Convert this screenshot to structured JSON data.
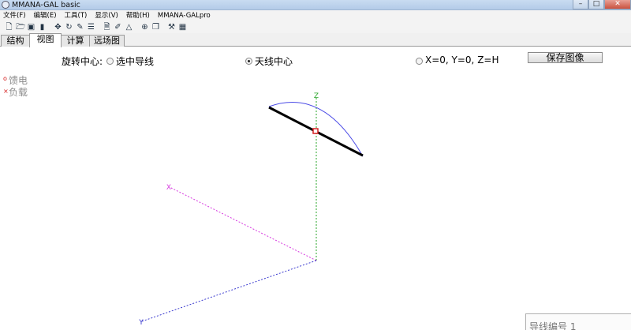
{
  "window": {
    "title": "MMANA-GAL basic",
    "minimize_glyph": "–",
    "maximize_glyph": "□",
    "close_glyph": "✕"
  },
  "menu": [
    "文件(F)",
    "编辑(E)",
    "工具(T)",
    "显示(V)",
    "帮助(H)",
    "MMANA-GALpro"
  ],
  "toolbar": {
    "icons": [
      "new-file-icon",
      "open-folder-icon",
      "save-disk-icon",
      "info-icon",
      "move-icon",
      "rotate-icon",
      "edit-icon",
      "settings-icon",
      "document-icon",
      "pen-icon",
      "triangle-icon",
      "target-icon",
      "copy-icon",
      "tools-icon",
      "calculator-icon"
    ],
    "glyphs": [
      "🗋",
      "🗁",
      "▣",
      "▮",
      "✥",
      "↻",
      "✎",
      "☰",
      "🗎",
      "✐",
      "△",
      "⊕",
      "❐",
      "⚒",
      "▦"
    ]
  },
  "tabs": [
    "结构",
    "视图",
    "计算",
    "远场图"
  ],
  "active_tab": "视图",
  "view": {
    "rotation_center_label": "旋转中心:",
    "options": [
      "选中导线",
      "天线中心",
      "X=0, Y=0, Z=H"
    ],
    "selected_option": "天线中心",
    "save_button": "保存图像",
    "legend": {
      "feed": {
        "label": "馈电",
        "symbol": "o",
        "color": "#d62020"
      },
      "load": {
        "label": "负载",
        "symbol": "×",
        "color": "#d62020"
      }
    },
    "axes": {
      "x_label": "X",
      "y_label": "Y",
      "z_label": "Z",
      "x_color": "#d63adf",
      "y_color": "#3a3acf",
      "z_color": "#2aa62a"
    },
    "wire_color": "#000000",
    "pattern_color": "#4a4ae6",
    "feed_color": "#d62020"
  },
  "info_panel": {
    "label": "导线编号 1"
  }
}
